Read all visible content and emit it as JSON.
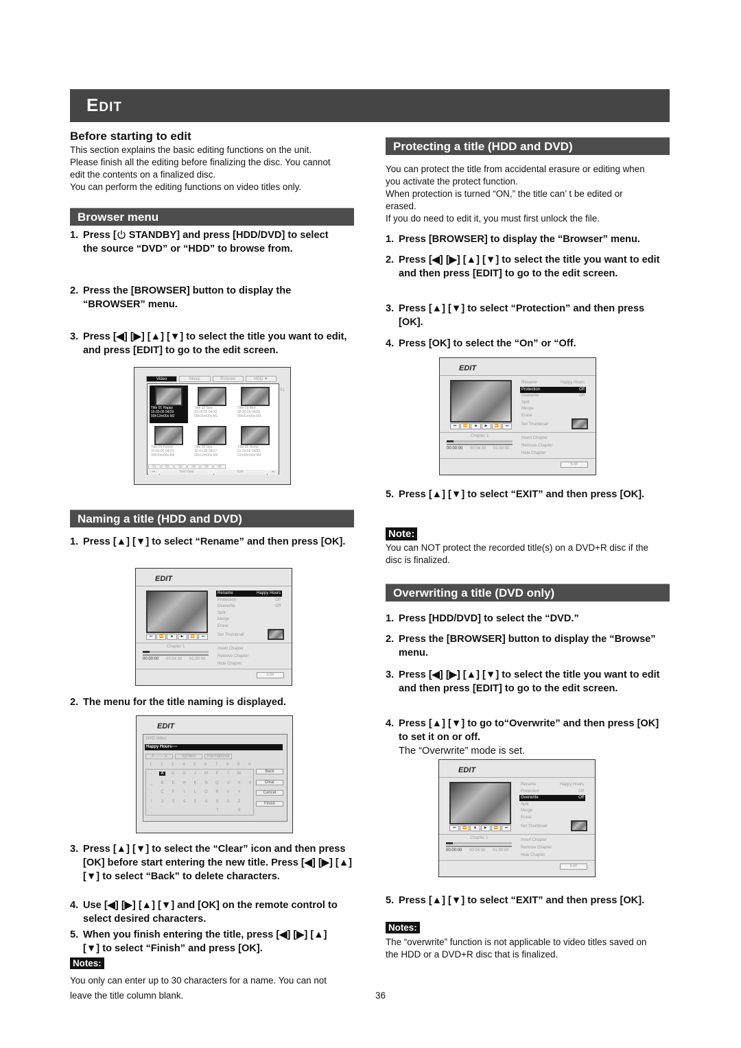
{
  "header": {
    "title_first": "E",
    "title_rest": "DIT"
  },
  "page_number": "36",
  "before": {
    "heading": "Before starting to edit",
    "lines": [
      "This section explains the basic editing functions on the unit.",
      "Please finish all the editing before finalizing the disc. You cannot",
      "edit the contents on a finalized disc.",
      "You can perform the editing functions on video titles only."
    ]
  },
  "browser_menu": {
    "heading": "Browser menu",
    "step1": {
      "n": "1.",
      "a": "Press [",
      "b": " STANDBY]  and press [HDD/DVD] to select the source “DVD” or “HDD” to browse from."
    },
    "step2": {
      "n": "2.",
      "t": "Press the [BROWSER] button to display the “BROWSER” menu."
    },
    "step3": {
      "n": "3.",
      "t": "Press [◀] [▶] [▲] [▼] to select the title you want to edit, and press [EDIT] to go to the edit screen."
    },
    "screen": {
      "tabs": [
        "Video",
        "Music",
        "Pictures",
        "HDD ▼"
      ],
      "thumbs": [
        [
          "Title 01 Happy",
          "15:30:05 04/20",
          "00h12m00s M2"
        ],
        [
          "Title 02 Sea",
          "23:00:05 04/22",
          "00h31m00s M1"
        ],
        [
          "Title 03 Bird",
          "08:30:26 04/26",
          "00h31m00s M3"
        ],
        [
          "Title 04 Forest",
          "20:00:00 04/23",
          "00h30m00s M6"
        ],
        [
          "Title 05 Sea",
          "18:41:08 04/27",
          "00h12m00s M2"
        ],
        [
          "Title 06 Home",
          "01:20:56 04/20",
          "01h30m00s M4"
        ]
      ],
      "pages": [
        "01",
        "02",
        "03",
        "04",
        "05",
        "06"
      ],
      "text_view": "Text View",
      "exit": "Exit",
      "page_indicator": "01"
    }
  },
  "naming": {
    "heading": "Naming a title  (HDD and DVD)",
    "step1": {
      "n": "1.",
      "t": "Press [▲] [▼] to select “Rename” and then press [OK]."
    },
    "step2": {
      "n": "2.",
      "t": "The menu for the title naming is displayed."
    },
    "step3": {
      "n": "3.",
      "t": "Press [▲] [▼] to select the “Clear” icon and then press [OK] before start entering the new title. Press [◀] [▶] [▲] [▼] to select “Back” to delete characters."
    },
    "step4": {
      "n": "4.",
      "t": "Use [◀] [▶] [▲] [▼] and [OK] on the remote control to select desired characters."
    },
    "step5": {
      "n": "5.",
      "t": "When you finish entering the title, press [◀] [▶] [▲] [▼] to select “Finish” and press [OK]."
    },
    "notes_label": "Notes:",
    "notes_lines": [
      "You only can enter up to 30 characters for a name. You can not",
      "leave the title column blank."
    ],
    "keyboard": {
      "title": "EDIT",
      "source": "DVD Video",
      "name": "Happy Hours----",
      "modes": [
        "A ------ a",
        "Symbol",
        "International"
      ],
      "digits": [
        "1",
        "2",
        "3",
        "4",
        "5",
        "6",
        "7",
        "8",
        "9",
        "0"
      ],
      "rows": [
        [
          "-",
          "A",
          "D",
          "G",
          "J",
          "M",
          "P",
          "T",
          "W",
          ""
        ],
        [
          "_",
          "B",
          "E",
          "H",
          "K",
          "N",
          "Q",
          "U",
          "X",
          "0"
        ],
        [
          ":",
          "C",
          "F",
          "I",
          "L",
          "O",
          "R",
          "V",
          "Y",
          ""
        ],
        [
          "!",
          "2",
          "3",
          "4",
          "5",
          "6",
          "S",
          "8",
          "Z",
          ""
        ],
        [
          "",
          "",
          "",
          "",
          "",
          "",
          "7",
          "",
          "9",
          ""
        ]
      ],
      "buttons": [
        "Back",
        "Clear",
        "Cancel",
        "Finish"
      ]
    }
  },
  "edit_screen": {
    "title": "EDIT",
    "menu": [
      [
        "Rename",
        "Happy Hours"
      ],
      [
        "Protection",
        "Off"
      ],
      [
        "Overwrite",
        "Off"
      ],
      [
        "Split",
        ""
      ],
      [
        "Merge",
        ""
      ],
      [
        "Erase",
        ""
      ]
    ],
    "set_thumbnail": "Set Thumbnail",
    "chapter": "Chapter 1",
    "times": [
      "00:00:00",
      "00:04:30",
      "01:30:00"
    ],
    "chapter_menu": [
      "Insert Chapter",
      "Remove Chapter",
      "Hide Chapter"
    ],
    "exit": "Exit",
    "transport": [
      "⏮",
      "⏪",
      "■",
      "▶",
      "⏩",
      "⏭"
    ]
  },
  "protect": {
    "heading": "Protecting a title  (HDD and DVD)",
    "lines": [
      "You can protect the title from accidental erasure or editing when",
      "you activate the protect function.",
      "When protection is turned “ON,” the title can’ t be edited or",
      "erased.",
      "If you do need to edit it, you must first unlock the file."
    ],
    "step1": {
      "n": "1.",
      "t": "Press [BROWSER] to display the “Browser” menu."
    },
    "step2": {
      "n": "2.",
      "t": "Press [◀] [▶] [▲] [▼] to select the title you want to edit and then press [EDIT] to go to the edit screen."
    },
    "step3": {
      "n": "3.",
      "t": "Press [▲] [▼] to select “Protection” and then press [OK]."
    },
    "step4": {
      "n": "4.",
      "t": "Press [OK] to select the “On” or “Off."
    },
    "step5": {
      "n": "5.",
      "t": "Press [▲]  [▼] to select “EXIT” and then press [OK]."
    },
    "note_label": "Note:",
    "note_lines": [
      "You can NOT protect the recorded title(s) on a DVD+R disc if the",
      "disc is finalized."
    ]
  },
  "overwrite": {
    "heading": "Overwriting a title (DVD only)",
    "step1": {
      "n": "1.",
      "t": "Press [HDD/DVD] to select the “DVD.”"
    },
    "step2": {
      "n": "2.",
      "t": "Press the [BROWSER] button to display the “Browse” menu."
    },
    "step3": {
      "n": "3.",
      "t": "Press [◀] [▶] [▲] [▼] to select the title you want to edit and then press [EDIT] to go to the edit screen."
    },
    "step4": {
      "n": "4.",
      "t": "Press [▲]  [▼] to go to“Overwrite” and then press [OK] to set it on or off.",
      "sub": "The “Overwrite” mode is set."
    },
    "step5": {
      "n": "5.",
      "t": "Press [▲]  [▼] to select “EXIT” and then press [OK]."
    },
    "notes_label": "Notes:",
    "notes_lines": [
      "The “overwrite” function is not applicable to video titles saved on",
      "the HDD or a DVD+R disc that is finalized."
    ]
  }
}
